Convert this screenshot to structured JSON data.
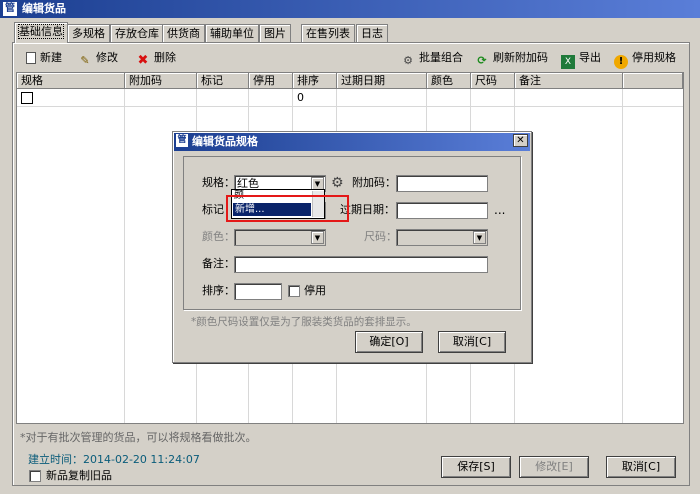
{
  "window": {
    "title": "编辑货品",
    "icon": "管"
  },
  "tabs": [
    "基础信息",
    "多规格",
    "存放仓库",
    "供货商",
    "辅助单位",
    "图片",
    "在售列表",
    "日志"
  ],
  "toolbar": {
    "new": "新建",
    "edit": "修改",
    "delete": "删除",
    "batch": "批量组合",
    "refresh_barcode": "刷新附加码",
    "export": "导出",
    "disable": "停用规格"
  },
  "grid": {
    "headers": [
      "规格",
      "附加码",
      "标记",
      "停用",
      "排序",
      "过期日期",
      "颜色",
      "尺码",
      "备注"
    ],
    "row": {
      "sort": "0"
    }
  },
  "dialog": {
    "title": "编辑货品规格",
    "labels": {
      "spec": "规格：",
      "barcode": "附加码：",
      "mark": "标记",
      "expiry": "过期日期：",
      "color": "颜色：",
      "size": "尺码：",
      "note": "备注：",
      "sort": "排序：",
      "disabled": "停用"
    },
    "spec_value": "红色",
    "dropdown_items": [
      "颜",
      "新增..."
    ],
    "expiry_more": "...",
    "hint": "*颜色尺码设置仅是为了服装类货品的套排显示。",
    "ok": "确定[O]",
    "cancel": "取消[C]"
  },
  "footer": {
    "hint": "*对于有批次管理的货品，可以将规格看做批次。",
    "created": "建立时间：2014-02-20 11:24:07",
    "copy_old": "新品复制旧品",
    "save": "保存[S]",
    "edit": "修改[E]",
    "cancel": "取消[C]"
  }
}
